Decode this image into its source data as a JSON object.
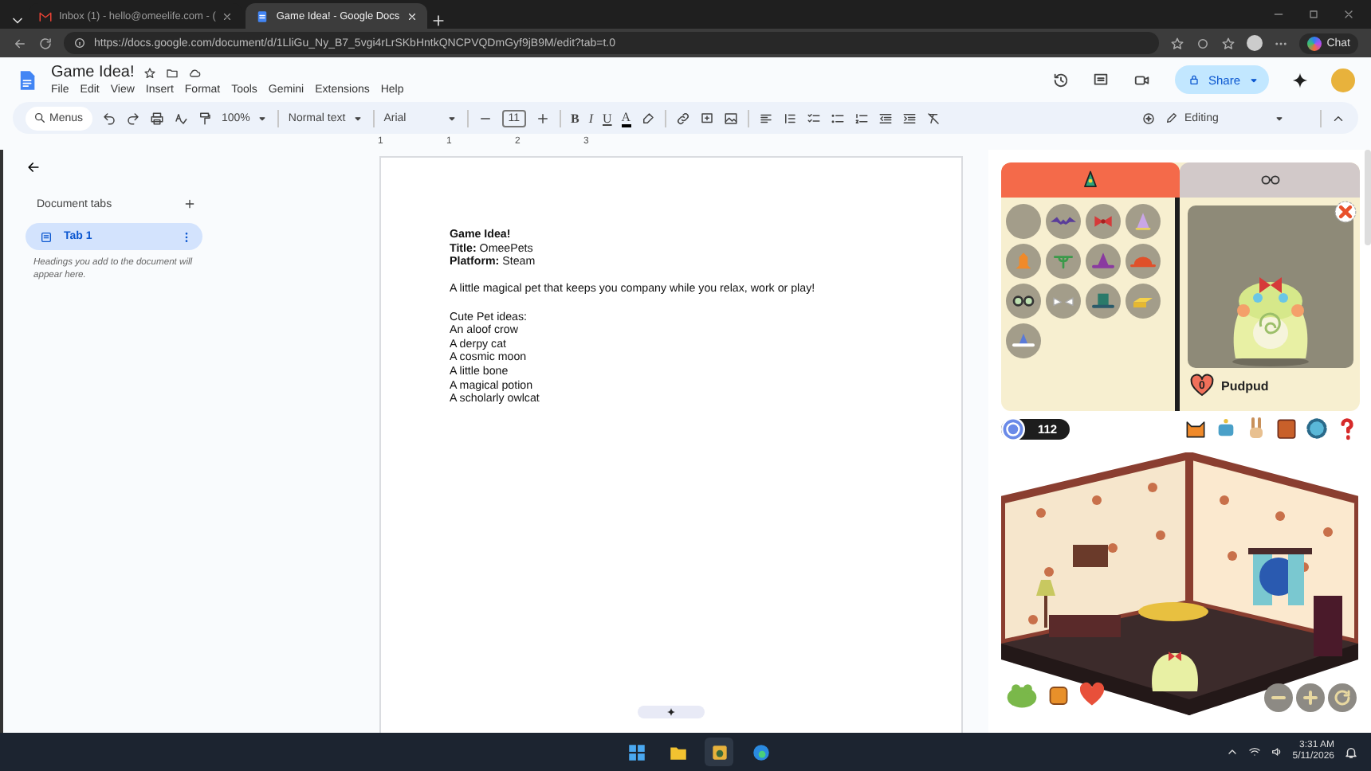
{
  "browser": {
    "tabs": [
      {
        "title": "Inbox (1) - hello@omeelife.com - (",
        "selected": false
      },
      {
        "title": "Game Idea! - Google Docs",
        "selected": true
      }
    ],
    "url": "https://docs.google.com/document/d/1LliGu_Ny_B7_5vgi4rLrSKbHntkQNCPVQDmGyf9jB9M/edit?tab=t.0",
    "chat_label": "Chat"
  },
  "docs": {
    "title": "Game Idea!",
    "menus": [
      "File",
      "Edit",
      "View",
      "Insert",
      "Format",
      "Tools",
      "Gemini",
      "Extensions",
      "Help"
    ],
    "share_label": "Share",
    "toolbar": {
      "search_placeholder": "Menus",
      "zoom": "100%",
      "style": "Normal text",
      "font": "Arial",
      "font_size": "11",
      "format_buttons": [
        "B",
        "I",
        "U",
        "A"
      ],
      "mode": "Editing"
    },
    "ruler": [
      "1",
      "1",
      "2",
      "3"
    ],
    "sidebar": {
      "heading": "Document tabs",
      "tabs": [
        {
          "label": "Tab 1",
          "selected": true
        }
      ],
      "hint": "Headings you add to the document will appear here."
    },
    "document": {
      "blocks": [
        {
          "lines": [
            {
              "text": "Game Idea!",
              "bold": true
            },
            {
              "text": "**Title:** OmeePets",
              "bold": false
            },
            {
              "text": "**Platform:** Steam",
              "bold": false
            }
          ]
        },
        {
          "lines": [
            {
              "text": "A little magical pet that keeps you company while you relax, work or play!",
              "bold": false
            }
          ]
        },
        {
          "lines": [
            {
              "text": "Cute Pet ideas:",
              "bold": false
            },
            {
              "text": "An aloof crow",
              "bold": false
            },
            {
              "text": "A derpy cat",
              "bold": false
            },
            {
              "text": "A cosmic moon",
              "bold": false
            },
            {
              "text": "A little bone",
              "bold": false
            },
            {
              "text": "A magical potion",
              "bold": false
            },
            {
              "text": "A scholarly owlcat",
              "bold": false
            }
          ]
        }
      ]
    }
  },
  "game": {
    "tabs": [
      {
        "kind": "hats",
        "selected": true
      },
      {
        "kind": "glasses",
        "selected": false
      }
    ],
    "pet": {
      "name": "Pudpud",
      "hearts": "0"
    },
    "coins": "112"
  },
  "taskbar": {
    "time": "3:31 AM",
    "date": "5/11/2026"
  }
}
